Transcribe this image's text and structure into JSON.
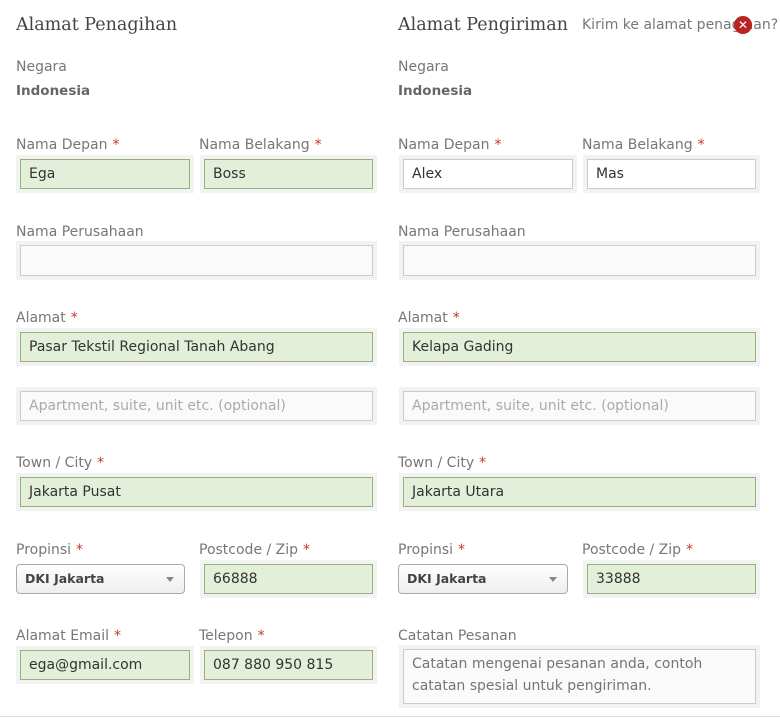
{
  "billing": {
    "title": "Alamat Penagihan",
    "country_label": "Negara",
    "country_value": "Indonesia",
    "first_name_label": "Nama Depan",
    "first_name_value": "Ega",
    "last_name_label": "Nama Belakang",
    "last_name_value": "Boss",
    "company_label": "Nama Perusahaan",
    "company_value": "",
    "address_label": "Alamat",
    "address_value": "Pasar Tekstil Regional Tanah Abang",
    "address2_placeholder": "Apartment, suite, unit etc. (optional)",
    "city_label": "Town / City",
    "city_value": "Jakarta Pusat",
    "province_label": "Propinsi",
    "province_value": "DKI Jakarta",
    "postcode_label": "Postcode / Zip",
    "postcode_value": "66888",
    "email_label": "Alamat Email",
    "email_value": "ega@gmail.com",
    "phone_label": "Telepon",
    "phone_value": "087 880 950 815"
  },
  "shipping": {
    "title": "Alamat Pengiriman",
    "ship_to_billing_label": "Kirim ke alamat penagihan?",
    "country_label": "Negara",
    "country_value": "Indonesia",
    "first_name_label": "Nama Depan",
    "first_name_value": "Alex",
    "last_name_label": "Nama Belakang",
    "last_name_value": "Mas",
    "company_label": "Nama Perusahaan",
    "company_value": "",
    "address_label": "Alamat",
    "address_value": "Kelapa Gading",
    "address2_placeholder": "Apartment, suite, unit etc. (optional)",
    "city_label": "Town / City",
    "city_value": "Jakarta Utara",
    "province_label": "Propinsi",
    "province_value": "DKI Jakarta",
    "postcode_label": "Postcode / Zip",
    "postcode_value": "33888",
    "notes_label": "Catatan Pesanan",
    "notes_placeholder": "Catatan mengenai pesanan anda, contoh catatan spesial untuk pengiriman."
  },
  "required_mark": "*",
  "close_glyph": "✕",
  "colors": {
    "valid_bg": "#e3efd9",
    "valid_border": "#96b17c",
    "required": "#c0392b",
    "error_icon": "#bb2222"
  }
}
